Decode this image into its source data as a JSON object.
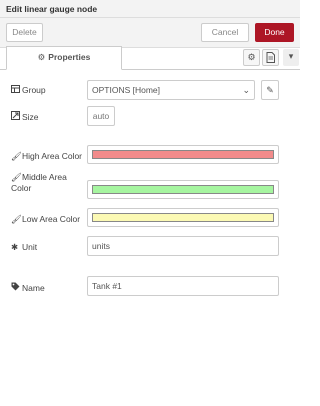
{
  "window": {
    "title": "Edit linear gauge node"
  },
  "toolbar": {
    "delete_label": "Delete",
    "cancel_label": "Cancel",
    "done_label": "Done"
  },
  "tabs": {
    "properties_label": "Properties"
  },
  "icons": {
    "settings": "gear-icon",
    "description": "document-icon",
    "more": "caret-down-icon",
    "group": "table-icon",
    "size": "resize-icon",
    "color": "paintbrush-icon",
    "unit": "asterisk-icon",
    "name": "tag-icon",
    "edit": "pencil-icon"
  },
  "form": {
    "group": {
      "label": "Group",
      "value": "OPTIONS [Home]"
    },
    "size": {
      "label": "Size",
      "value": "auto"
    },
    "high_color": {
      "label": "High Area Color",
      "color": "#f28b8b"
    },
    "middle_color": {
      "label": "Middle Area Color",
      "color": "#a6f5a0"
    },
    "low_color": {
      "label": "Low Area Color",
      "color": "#fbf9b4"
    },
    "unit": {
      "label": "Unit",
      "value": "units"
    },
    "name": {
      "label": "Name",
      "value": "Tank #1"
    }
  }
}
